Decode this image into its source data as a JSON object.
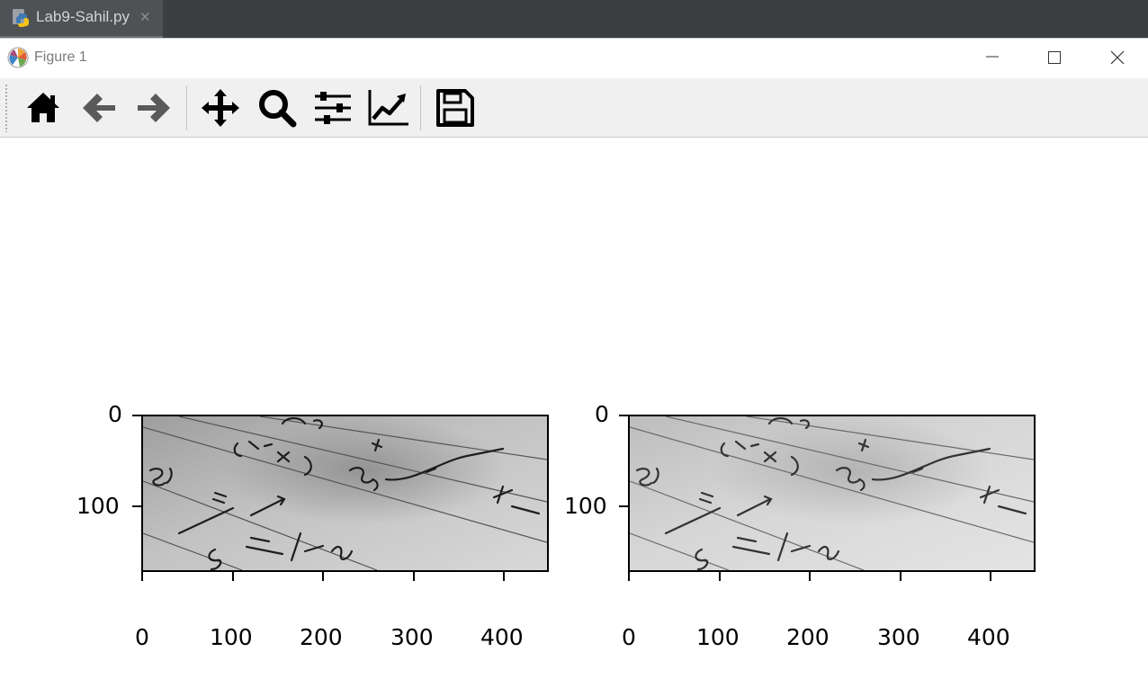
{
  "editor_tab": {
    "filename": "Lab9-Sahil.py",
    "close_glyph": "✕",
    "icon": "python-file-icon"
  },
  "window": {
    "title": "Figure 1",
    "icon": "matplotlib-icon",
    "controls": [
      "minimize-icon",
      "maximize-icon",
      "close-icon"
    ]
  },
  "toolbar": {
    "buttons": [
      {
        "name": "home",
        "icon": "home-icon"
      },
      {
        "name": "back",
        "icon": "back-arrow-icon"
      },
      {
        "name": "forward",
        "icon": "forward-arrow-icon"
      },
      {
        "name": "pan",
        "icon": "move-icon"
      },
      {
        "name": "zoom",
        "icon": "zoom-icon"
      },
      {
        "name": "configure-subplots",
        "icon": "sliders-icon"
      },
      {
        "name": "edit-axes",
        "icon": "chart-line-icon"
      },
      {
        "name": "save",
        "icon": "floppy-disk-icon"
      }
    ]
  },
  "figure": {
    "subplots": [
      {
        "name": "left-image",
        "xticks": [
          "0",
          "100",
          "200",
          "300",
          "400"
        ],
        "yticks": [
          "0",
          "100"
        ],
        "xlim": [
          0,
          449
        ],
        "ylim_inverted": [
          170,
          0
        ],
        "content": "grayscale photo of handwritten math on lined paper"
      },
      {
        "name": "right-image",
        "xticks": [
          "0",
          "100",
          "200",
          "300",
          "400"
        ],
        "yticks": [
          "0",
          "100"
        ],
        "xlim": [
          0,
          449
        ],
        "ylim_inverted": [
          170,
          0
        ],
        "content": "grayscale photo of handwritten math on lined paper (lighter)"
      }
    ]
  },
  "colors": {
    "tab_bar": "#3c3f41",
    "active_tab": "#4e5254",
    "toolbar_bg": "#f0f0f0",
    "icon_dark": "#000000",
    "icon_disabled": "#5a5a5a"
  }
}
